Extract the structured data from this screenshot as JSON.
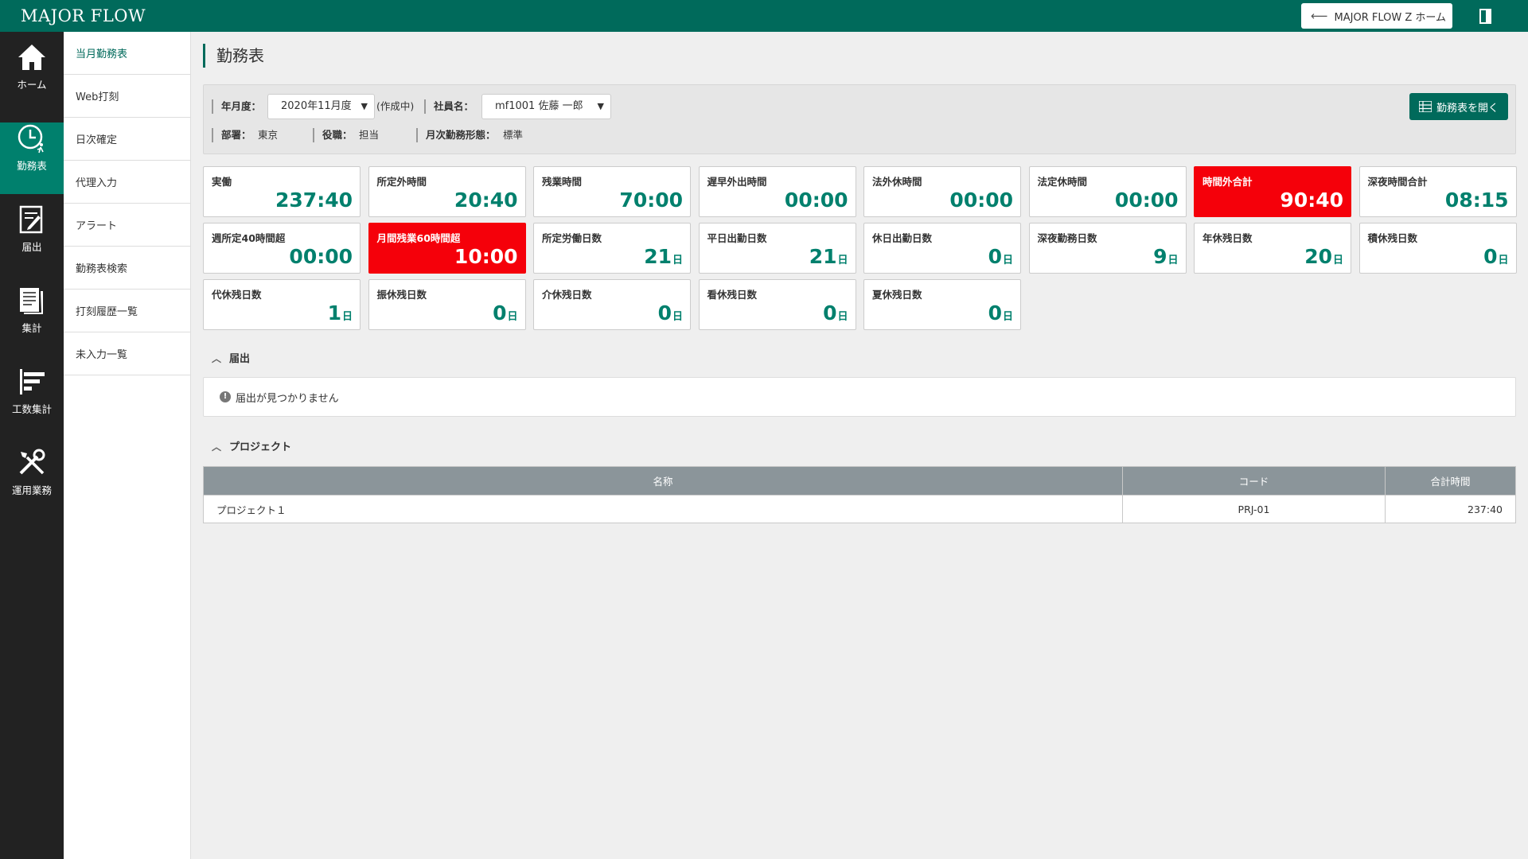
{
  "header": {
    "logo": "MAJOR FLOW",
    "home_button": "MAJOR FLOW Z ホーム",
    "colors": {
      "header_bg": "#006a5b",
      "accent": "#00806d",
      "alert": "#f5000a"
    }
  },
  "nav": {
    "items": [
      {
        "label": "ホーム",
        "icon": "home-icon"
      },
      {
        "label": "勤務表",
        "icon": "clock-icon",
        "active": true
      },
      {
        "label": "届出",
        "icon": "form-icon"
      },
      {
        "label": "集計",
        "icon": "documents-icon"
      },
      {
        "label": "工数集計",
        "icon": "bars-icon"
      },
      {
        "label": "運用業務",
        "icon": "tools-icon"
      }
    ]
  },
  "subnav": {
    "items": [
      "当月勤務表",
      "Web打刻",
      "日次確定",
      "代理入力",
      "アラート",
      "勤務表検索",
      "打刻履歴一覧",
      "未入力一覧"
    ]
  },
  "page": {
    "title": "勤務表"
  },
  "filter": {
    "year_month_label": "年月度：",
    "year_month_value": "2020年11月度",
    "status": "(作成中)",
    "employee_label": "社員名：",
    "employee_value": "mf1001 佐藤 一郎",
    "dept_label": "部署：",
    "dept_value": "東京",
    "role_label": "役職：",
    "role_value": "担当",
    "work_type_label": "月次勤務形態：",
    "work_type_value": "標準",
    "open_button": "勤務表を開く"
  },
  "stats": [
    {
      "label": "実働",
      "value": "237:40",
      "unit": ""
    },
    {
      "label": "所定外時間",
      "value": "20:40",
      "unit": ""
    },
    {
      "label": "残業時間",
      "value": "70:00",
      "unit": ""
    },
    {
      "label": "遅早外出時間",
      "value": "00:00",
      "unit": ""
    },
    {
      "label": "法外休時間",
      "value": "00:00",
      "unit": ""
    },
    {
      "label": "法定休時間",
      "value": "00:00",
      "unit": ""
    },
    {
      "label": "時間外合計",
      "value": "90:40",
      "unit": "",
      "alert": true
    },
    {
      "label": "深夜時間合計",
      "value": "08:15",
      "unit": ""
    },
    {
      "label": "週所定40時間超",
      "value": "00:00",
      "unit": ""
    },
    {
      "label": "月間残業60時間超",
      "value": "10:00",
      "unit": "",
      "alert": true
    },
    {
      "label": "所定労働日数",
      "value": "21",
      "unit": "日"
    },
    {
      "label": "平日出勤日数",
      "value": "21",
      "unit": "日"
    },
    {
      "label": "休日出勤日数",
      "value": "0",
      "unit": "日"
    },
    {
      "label": "深夜勤務日数",
      "value": "9",
      "unit": "日"
    },
    {
      "label": "年休残日数",
      "value": "20",
      "unit": "日"
    },
    {
      "label": "積休残日数",
      "value": "0",
      "unit": "日"
    },
    {
      "label": "代休残日数",
      "value": "1",
      "unit": "日"
    },
    {
      "label": "振休残日数",
      "value": "0",
      "unit": "日"
    },
    {
      "label": "介休残日数",
      "value": "0",
      "unit": "日"
    },
    {
      "label": "看休残日数",
      "value": "0",
      "unit": "日"
    },
    {
      "label": "夏休残日数",
      "value": "0",
      "unit": "日"
    }
  ],
  "notices_section": {
    "title": "届出",
    "empty_message": "届出が見つかりません"
  },
  "projects_section": {
    "title": "プロジェクト",
    "columns": [
      "名称",
      "コード",
      "合計時間"
    ],
    "rows": [
      [
        "プロジェクト１",
        "PRJ-01",
        "237:40"
      ]
    ]
  }
}
